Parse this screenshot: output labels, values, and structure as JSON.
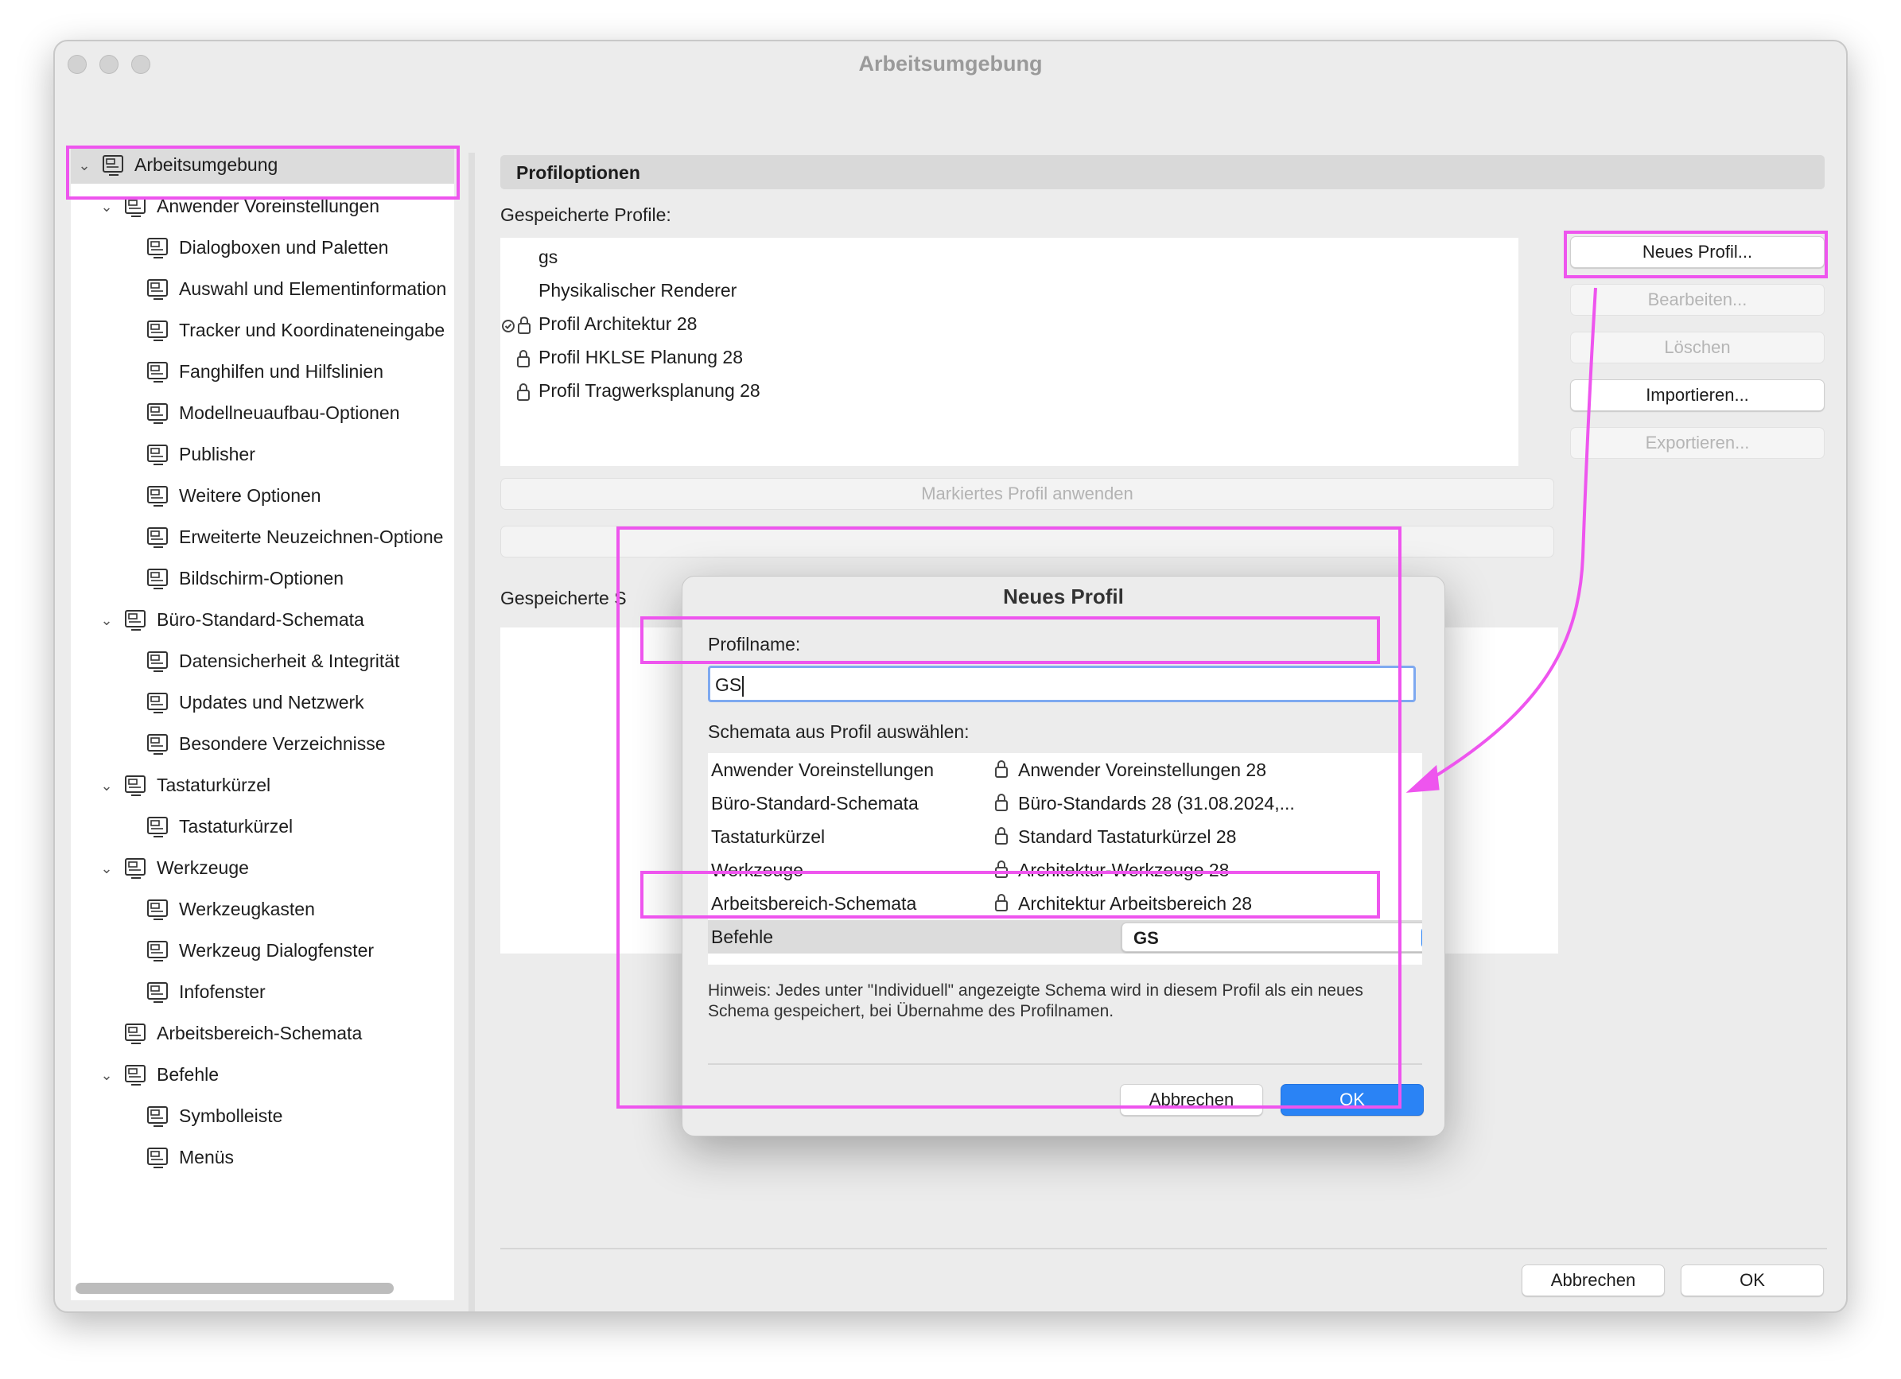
{
  "window": {
    "title": "Arbeitsumgebung"
  },
  "sidebar": {
    "items": [
      {
        "label": "Arbeitsumgebung",
        "icon": "workspace-icon"
      },
      {
        "label": "Anwender Voreinstellungen",
        "icon": "user-prefs-icon"
      },
      {
        "label": "Dialogboxen und Paletten",
        "icon": "dialogs-icon"
      },
      {
        "label": "Auswahl und Elementinformation",
        "icon": "selection-info-icon"
      },
      {
        "label": "Tracker und Koordinateneingabe",
        "icon": "xyz-icon"
      },
      {
        "label": "Fanghilfen und Hilfslinien",
        "icon": "snap-guides-icon"
      },
      {
        "label": "Modellneuaufbau-Optionen",
        "icon": "rebuild-icon"
      },
      {
        "label": "Publisher",
        "icon": "publisher-icon"
      },
      {
        "label": "Weitere Optionen",
        "icon": "sliders-icon"
      },
      {
        "label": "Erweiterte Neuzeichnen-Optione",
        "icon": "redraw-icon"
      },
      {
        "label": "Bildschirm-Optionen",
        "icon": "screen-icon"
      },
      {
        "label": "Büro-Standard-Schemata",
        "icon": "office-schemes-icon"
      },
      {
        "label": "Datensicherheit & Integrität",
        "icon": "data-safety-icon"
      },
      {
        "label": "Updates und Netzwerk",
        "icon": "globe-icon"
      },
      {
        "label": "Besondere Verzeichnisse",
        "icon": "folder-icon"
      },
      {
        "label": "Tastaturkürzel",
        "icon": "keyboard-scheme-icon"
      },
      {
        "label": "Tastaturkürzel",
        "icon": "shortcut-icon"
      },
      {
        "label": "Werkzeuge",
        "icon": "tools-scheme-icon"
      },
      {
        "label": "Werkzeugkasten",
        "icon": "toolbox-icon"
      },
      {
        "label": "Werkzeug Dialogfenster",
        "icon": "tool-dialog-icon"
      },
      {
        "label": "Infofenster",
        "icon": "info-box-icon"
      },
      {
        "label": "Arbeitsbereich-Schemata",
        "icon": "work-env-scheme-icon"
      },
      {
        "label": "Befehle",
        "icon": "commands-scheme-icon"
      },
      {
        "label": "Symbolleiste",
        "icon": "toolbar-icon"
      },
      {
        "label": "Menüs",
        "icon": "menus-icon"
      }
    ]
  },
  "main": {
    "section_title": "Profiloptionen",
    "saved_profiles_label": "Gespeicherte Profile:",
    "profiles": [
      "gs",
      "Physikalischer Renderer",
      "Profil Architektur 28",
      "Profil HKLSE Planung 28",
      "Profil Tragwerksplanung 28"
    ],
    "buttons": {
      "new_profile": "Neues Profil...",
      "edit": "Bearbeiten...",
      "delete": "Löschen",
      "import": "Importieren...",
      "export": "Exportieren..."
    },
    "apply_button": "Markiertes Profil anwenden",
    "saved_schemes_label": "Gespeicherte S",
    "cancel": "Abbrechen",
    "ok": "OK"
  },
  "dialog": {
    "title": "Neues Profil",
    "profile_name_label": "Profilname:",
    "profile_name_value": "GS",
    "schemes_label": "Schemata aus Profil auswählen:",
    "rows": [
      {
        "name": "Anwender Voreinstellungen",
        "value": "Anwender Voreinstellungen 28"
      },
      {
        "name": "Büro-Standard-Schemata",
        "value": "Büro-Standards 28  (31.08.2024,..."
      },
      {
        "name": "Tastaturkürzel",
        "value": "Standard Tastaturkürzel 28"
      },
      {
        "name": "Werkzeuge",
        "value": "Architektur-Werkzeuge 28"
      },
      {
        "name": "Arbeitsbereich-Schemata",
        "value": "Architektur Arbeitsbereich 28"
      },
      {
        "name": "Befehle",
        "value": "GS"
      }
    ],
    "hint": "Hinweis: Jedes unter \"Individuell\" angezeigte Schema wird in diesem Profil als ein neues Schema gespeichert, bei Übernahme des Profilnamen.",
    "cancel": "Abbrechen",
    "ok": "OK"
  },
  "colors": {
    "accent": "#2a83f5",
    "annotation": "#ee55ee",
    "selection": "#dcdcdc"
  }
}
